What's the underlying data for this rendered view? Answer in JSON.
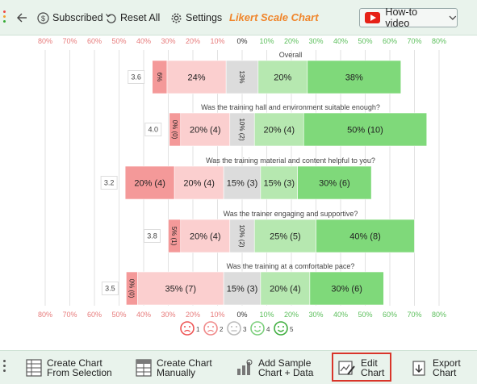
{
  "toolbar": {
    "subscribed_label": "Subscribed",
    "reset_label": "Reset All",
    "settings_label": "Settings",
    "chart_title": "Likert Scale Chart",
    "howto_label": "How-to video"
  },
  "colors": {
    "toolbar_bg": "#e9f3ec",
    "title_orange": "#f0852b",
    "neg_strong": "#f49999",
    "neg_light": "#fbcfcf",
    "neutral": "#dcdcdc",
    "pos_light": "#b6e8b0",
    "pos_strong": "#7fd97a",
    "neg_tick": "#e77b7b",
    "pos_tick": "#5cbf5c",
    "highlight": "#d9352a"
  },
  "chart_data": {
    "type": "bar",
    "orientation": "horizontal",
    "stacked": "diverging",
    "axis_ticks": [
      "80%",
      "70%",
      "60%",
      "50%",
      "40%",
      "30%",
      "20%",
      "10%",
      "0%",
      "10%",
      "20%",
      "30%",
      "40%",
      "50%",
      "60%",
      "70%",
      "80%"
    ],
    "xlim": [
      -80,
      80
    ],
    "grid": true,
    "rows": [
      {
        "question": "Overall",
        "score": "3.6",
        "values": [
          6,
          24,
          13,
          20,
          38
        ],
        "labels": [
          "6%",
          "24%",
          "13%",
          "20%",
          "38%"
        ],
        "vertical": [
          true,
          false,
          true,
          false,
          false
        ]
      },
      {
        "question": "Was the training hall and environment suitable enough?",
        "score": "4.0",
        "values": [
          0,
          20,
          10,
          20,
          50
        ],
        "labels": [
          "0% (0)",
          "20% (4)",
          "10% (2)",
          "20% (4)",
          "50% (10)"
        ],
        "vertical": [
          true,
          false,
          true,
          false,
          false
        ]
      },
      {
        "question": "Was the training material and content helpful to you?",
        "score": "3.2",
        "values": [
          20,
          20,
          15,
          15,
          30
        ],
        "labels": [
          "20% (4)",
          "20% (4)",
          "15% (3)",
          "15% (3)",
          "30% (6)"
        ],
        "vertical": [
          false,
          false,
          false,
          false,
          false
        ]
      },
      {
        "question": "Was the trainer engaging and supportive?",
        "score": "3.8",
        "values": [
          5,
          20,
          10,
          25,
          40
        ],
        "labels": [
          "5% (1)",
          "20% (4)",
          "10% (2)",
          "25% (5)",
          "40% (8)"
        ],
        "vertical": [
          true,
          false,
          true,
          false,
          false
        ]
      },
      {
        "question": "Was the training at a comfortable pace?",
        "score": "3.5",
        "values": [
          0,
          35,
          15,
          20,
          30
        ],
        "labels": [
          "0% (0)",
          "35% (7)",
          "15% (3)",
          "20% (4)",
          "30% (6)"
        ],
        "vertical": [
          true,
          false,
          false,
          false,
          false
        ]
      }
    ],
    "legend": {
      "position": "bottom",
      "entries": [
        "1",
        "2",
        "3",
        "4",
        "5"
      ]
    }
  },
  "bottombar": {
    "create_selection": [
      "Create Chart",
      "From Selection"
    ],
    "create_manual": [
      "Create Chart",
      "Manually"
    ],
    "add_sample": [
      "Add Sample",
      "Chart + Data"
    ],
    "edit_chart": [
      "Edit",
      "Chart"
    ],
    "export_chart": [
      "Export",
      "Chart"
    ]
  }
}
